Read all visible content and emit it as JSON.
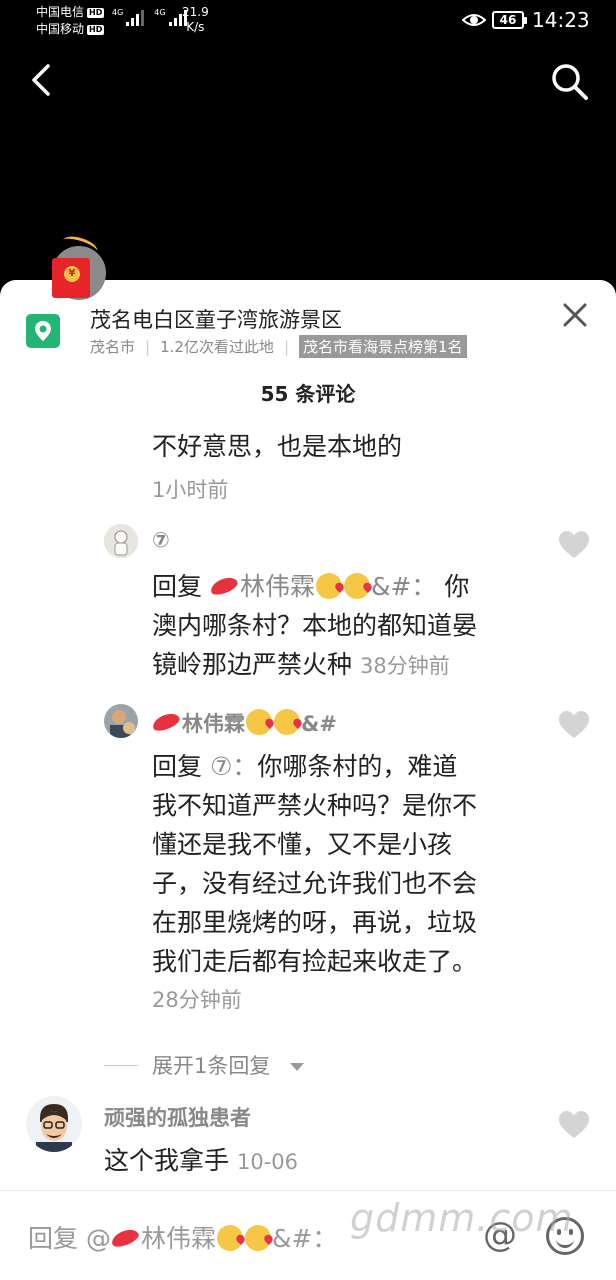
{
  "status_bar": {
    "carrier_1": "中国电信",
    "carrier_2": "中国移动",
    "hd_label": "HD",
    "net_label": "4G",
    "speed_value": "21.9",
    "speed_unit": "K/s",
    "battery": "46",
    "time": "14:23"
  },
  "location": {
    "title": "茂名电白区童子湾旅游景区",
    "city": "茂名市",
    "views": "1.2亿次看过此地",
    "rank": "茂名市看海景点榜第1名"
  },
  "comment_count": "55 条评论",
  "comments": [
    {
      "text": "不好意思，也是本地的",
      "time": "1小时前"
    },
    {
      "author": "⑦",
      "reply_prefix": "回复",
      "reply_to": "林伟霖",
      "reply_to_suffix": "&#：",
      "text_line1": "你",
      "text_line2": "澳内哪条村？本地的都知道晏",
      "text_line3": "镜岭那边严禁火种",
      "time": "38分钟前"
    },
    {
      "author": "林伟霖",
      "author_suffix": "&#",
      "reply_prefix": "回复",
      "reply_to": "⑦：",
      "lines": [
        "你哪条村的，难道",
        "我不知道严禁火种吗？是你不",
        "懂还是我不懂，又不是小孩",
        "子，没有经过允许我们也不会",
        "在那里烧烤的呀，再说，垃圾",
        "我们走后都有捡起来收走了。"
      ],
      "time": "28分钟前"
    },
    {
      "author": "顽强的孤独患者",
      "text": "这个我拿手",
      "time": "10-06"
    }
  ],
  "expand_replies": "展开1条回复",
  "input": {
    "prefix": "回复 @",
    "name": "林伟霖",
    "suffix": "&#："
  },
  "watermark": "gdmm.com",
  "icons": {
    "back": "back-arrow-icon",
    "search": "search-icon",
    "close": "close-icon",
    "heart": "heart-icon",
    "at": "at-icon",
    "emoji": "emoji-icon",
    "location": "location-pin-icon",
    "red_packet": "red-packet-icon"
  },
  "colors": {
    "location_green": "#22b573",
    "packet_red": "#e8242b",
    "rank_tag_bg": "#999999"
  }
}
